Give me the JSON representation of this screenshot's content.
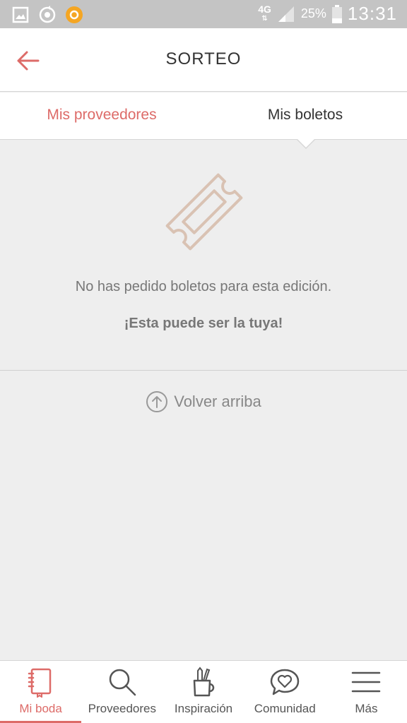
{
  "status_bar": {
    "network": "4G",
    "battery": "25%",
    "time": "13:31"
  },
  "header": {
    "title": "SORTEO"
  },
  "tabs": [
    {
      "label": "Mis proveedores",
      "active": true
    },
    {
      "label": "Mis boletos",
      "active": false
    }
  ],
  "empty_state": {
    "icon": "ticket-icon",
    "message": "No has pedido boletos para esta edición.",
    "cta": "¡Esta puede ser la tuya!"
  },
  "back_to_top": {
    "label": "Volver arriba"
  },
  "bottom_nav": [
    {
      "label": "Mi boda",
      "icon": "notebook-icon",
      "active": true
    },
    {
      "label": "Proveedores",
      "icon": "search-icon",
      "active": false
    },
    {
      "label": "Inspiración",
      "icon": "pencil-cup-icon",
      "active": false
    },
    {
      "label": "Comunidad",
      "icon": "heart-chat-icon",
      "active": false
    },
    {
      "label": "Más",
      "icon": "menu-icon",
      "active": false
    }
  ],
  "colors": {
    "accent": "#dd6b68",
    "background": "#eeeeee",
    "status_bar": "#c4c4c4"
  }
}
